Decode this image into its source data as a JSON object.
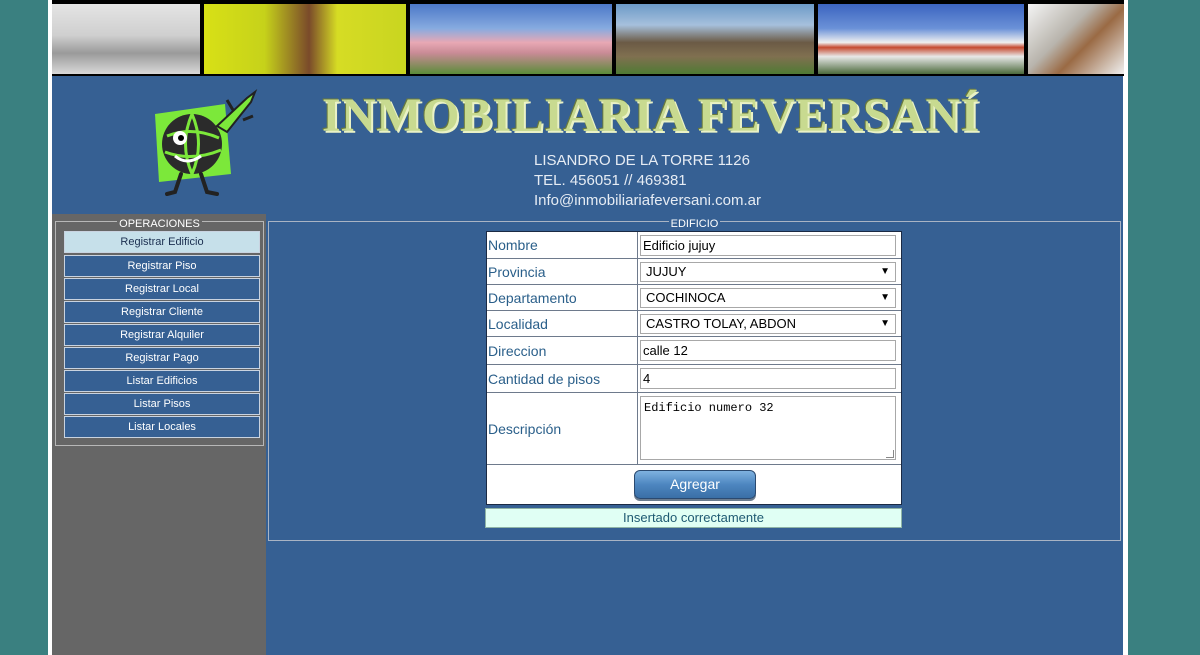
{
  "header": {
    "brand": "INMOBILIARIA FEVERSANÍ",
    "address": "LISANDRO DE LA TORRE 1126",
    "phone": "TEL. 456051 // 469381",
    "email": "Info@inmobiliariafeversani.com.ar"
  },
  "sidebar": {
    "legend": "OPERACIONES",
    "items": [
      {
        "label": "Registrar Edificio",
        "active": true
      },
      {
        "label": "Registrar Piso"
      },
      {
        "label": "Registrar Local"
      },
      {
        "label": "Registrar Cliente"
      },
      {
        "label": "Registrar Alquiler"
      },
      {
        "label": "Registrar Pago"
      },
      {
        "label": "Listar Edificios"
      },
      {
        "label": "Listar Pisos"
      },
      {
        "label": "Listar Locales"
      }
    ]
  },
  "form": {
    "legend": "EDIFICIO",
    "nombre": {
      "label": "Nombre",
      "value": "Edificio jujuy"
    },
    "provincia": {
      "label": "Provincia",
      "value": "JUJUY"
    },
    "departamento": {
      "label": "Departamento",
      "value": "COCHINOCA"
    },
    "localidad": {
      "label": "Localidad",
      "value": "CASTRO TOLAY, ABDON"
    },
    "direccion": {
      "label": "Direccion",
      "value": "calle 12"
    },
    "pisos": {
      "label": "Cantidad de pisos",
      "value": "4"
    },
    "descripcion": {
      "label": "Descripción",
      "value": "Edificio numero 32"
    },
    "submit_label": "Agregar",
    "status": "Insertado correctamente"
  },
  "colors": {
    "page_bg": "#3a8080",
    "header_bg": "#366093",
    "sidebar_bg": "#666666",
    "active_menu": "#c6e0ea",
    "brand_text": "#c8da90",
    "status_bg": "#e0fff4"
  }
}
